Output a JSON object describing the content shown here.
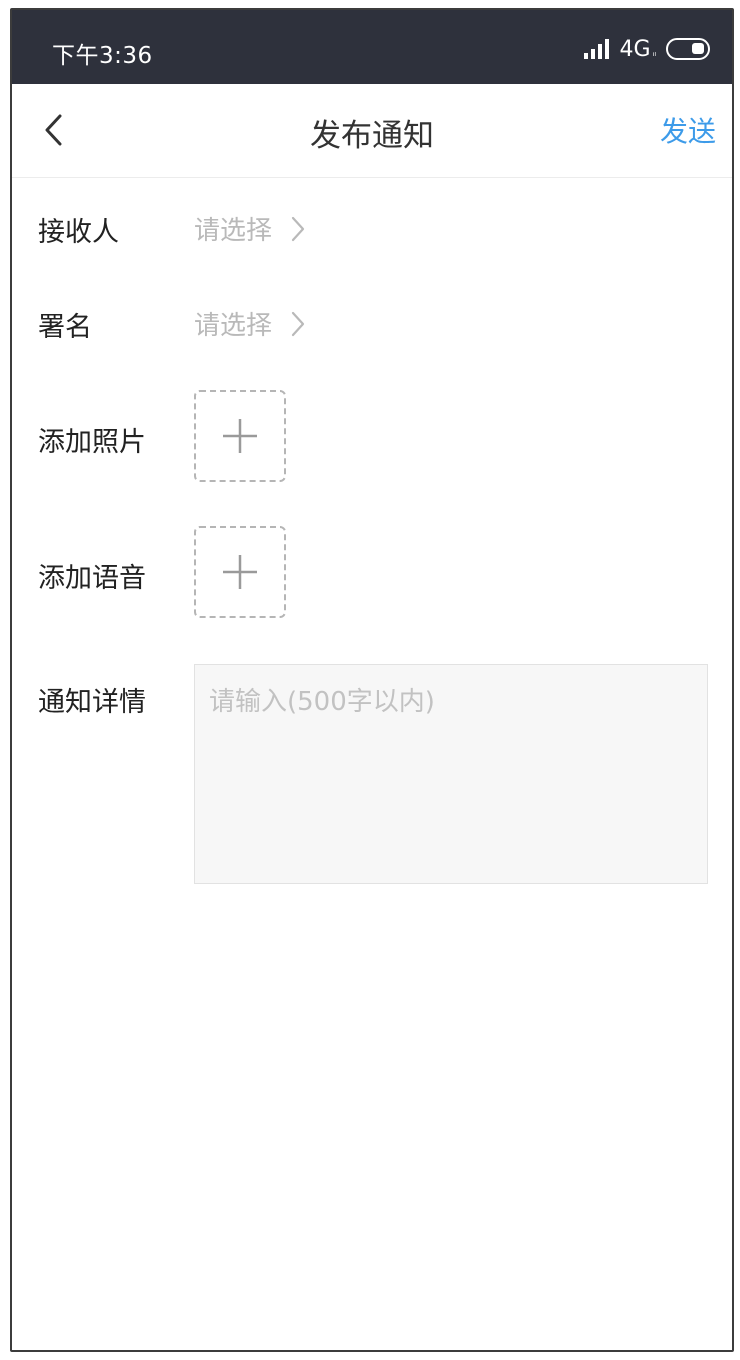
{
  "status_bar": {
    "time": "下午3:36",
    "network": "4G",
    "network_sub": "ᵢₗ"
  },
  "nav": {
    "title": "发布通知",
    "send_label": "发送"
  },
  "form": {
    "recipient": {
      "label": "接收人",
      "value": "请选择"
    },
    "signature": {
      "label": "署名",
      "value": "请选择"
    },
    "photo": {
      "label": "添加照片"
    },
    "voice": {
      "label": "添加语音"
    },
    "details": {
      "label": "通知详情",
      "placeholder": "请输入(500字以内)"
    }
  },
  "colors": {
    "status_bar_bg": "#2e313c",
    "accent": "#3d9be9",
    "placeholder": "#b9b9b9"
  }
}
